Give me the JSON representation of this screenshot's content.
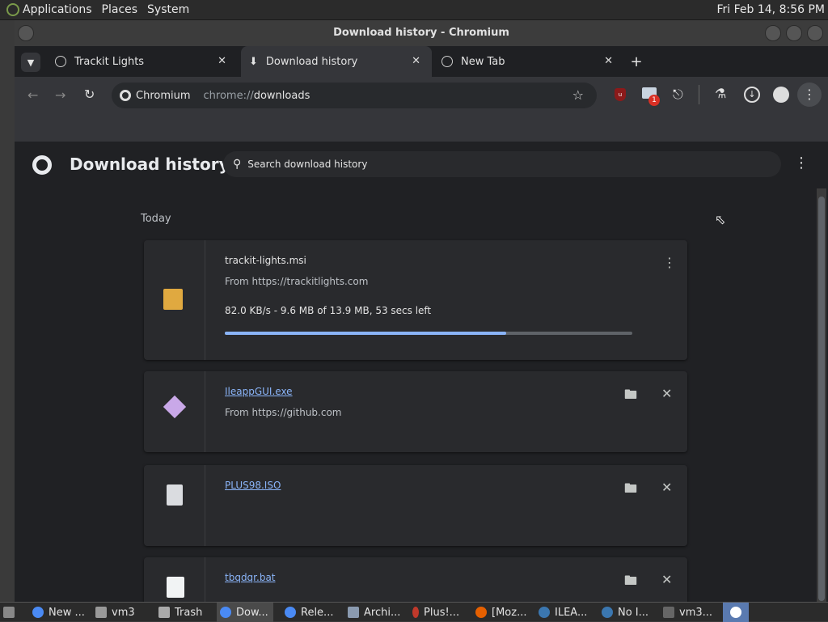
{
  "topbar": {
    "apps": "Applications",
    "places": "Places",
    "system": "System",
    "clock": "Fri Feb 14,  8:56 PM"
  },
  "window": {
    "title": "Download history - Chromium"
  },
  "tabs": [
    {
      "label": "Trackit Lights"
    },
    {
      "label": "Download history"
    },
    {
      "label": "New Tab"
    }
  ],
  "omnibox": {
    "site": "Chromium",
    "url_prefix": "chrome://",
    "url_path": "downloads"
  },
  "toolbar": {
    "ext_badge": "1"
  },
  "page": {
    "title": "Download history",
    "search_placeholder": "Search download history",
    "section": "Today"
  },
  "downloads": [
    {
      "name": "trackit-lights.msi",
      "source": "From https://trackitlights.com",
      "status": "82.0 KB/s - 9.6 MB of 13.9 MB, 53 secs left",
      "progress": 0.69
    },
    {
      "name": "IleappGUI.exe",
      "source": "From https://github.com"
    },
    {
      "name": "PLUS98.ISO",
      "source": ""
    },
    {
      "name": "tbqdqr.bat",
      "source": ""
    }
  ],
  "taskbar": [
    {
      "label": "New ..."
    },
    {
      "label": "vm3"
    },
    {
      "label": "Trash"
    },
    {
      "label": "Dow..."
    },
    {
      "label": "Rele..."
    },
    {
      "label": "Archi..."
    },
    {
      "label": "Plus!..."
    },
    {
      "label": "[Moz..."
    },
    {
      "label": "ILEA..."
    },
    {
      "label": "No I..."
    },
    {
      "label": "vm3..."
    }
  ]
}
